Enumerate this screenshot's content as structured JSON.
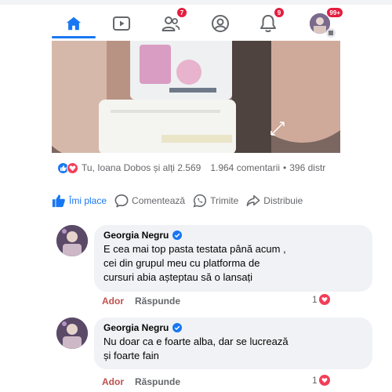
{
  "nav": {
    "items": [
      {
        "name": "home",
        "badge": ""
      },
      {
        "name": "watch",
        "badge": ""
      },
      {
        "name": "friends",
        "badge": "7"
      },
      {
        "name": "profile",
        "badge": ""
      },
      {
        "name": "notifications",
        "badge": "9"
      },
      {
        "name": "menu",
        "badge": "99+"
      }
    ],
    "accent": "#1877f2",
    "badge_color": "#e41e3f"
  },
  "post": {
    "reactions_text": "Tu, Ioana Dobos și alți 2.569",
    "comments_count": "1.964 comentarii",
    "shares_count": "396 distr",
    "actions": {
      "like": "Îmi place",
      "comment": "Comentează",
      "send": "Trimite",
      "share": "Distribuie"
    }
  },
  "comments": [
    {
      "author": "Georgia Negru",
      "text_lines": [
        "E cea mai top pasta testata până acum ,",
        "cei din grupul meu cu platforma de",
        "cursuri abia așteptau să o lansați"
      ],
      "like_label": "Ador",
      "reply_label": "Răspunde",
      "likes": "1"
    },
    {
      "author": "Georgia Negru",
      "text_lines": [
        "Nu doar ca e foarte alba, dar se lucrează",
        "și foarte fain"
      ],
      "like_label": "Ador",
      "reply_label": "Răspunde",
      "likes": "1"
    }
  ],
  "colors": {
    "ador": "#c0504d",
    "heart": "#f33e58",
    "bubble": "#f0f2f5"
  }
}
